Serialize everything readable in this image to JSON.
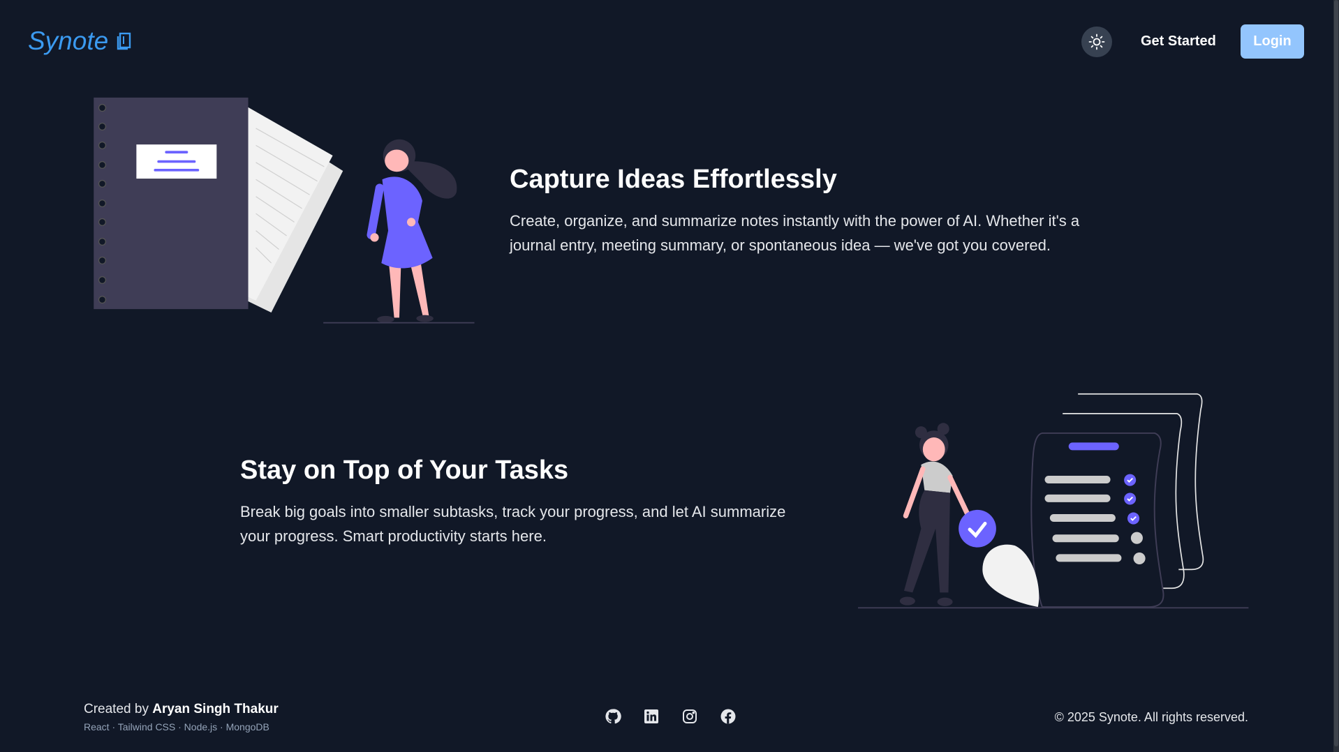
{
  "header": {
    "logo_text": "Synote",
    "logo_icon": "book-icon",
    "theme_toggle_icon": "sun-icon",
    "get_started_label": "Get Started",
    "login_label": "Login"
  },
  "sections": [
    {
      "title": "Capture Ideas Effortlessly",
      "body": "Create, organize, and summarize notes instantly with the power of AI. Whether it's a journal entry, meeting summary, or spontaneous idea — we've got you covered."
    },
    {
      "title": "Stay on Top of Your Tasks",
      "body": "Break big goals into smaller subtasks, track your progress, and let AI summarize your progress. Smart productivity starts here."
    }
  ],
  "footer": {
    "created_by_prefix": "Created by",
    "author": "Aryan Singh Thakur",
    "tech_stack": "React · Tailwind CSS · Node.js · MongoDB",
    "social_icons": [
      "github-icon",
      "linkedin-icon",
      "instagram-icon",
      "facebook-icon"
    ],
    "copyright": "© 2025 Synote. All rights reserved."
  },
  "colors": {
    "background": "#111827",
    "brand": "#3b9af0",
    "login_button": "#93c5fd",
    "accent_illustration": "#6c63ff"
  }
}
